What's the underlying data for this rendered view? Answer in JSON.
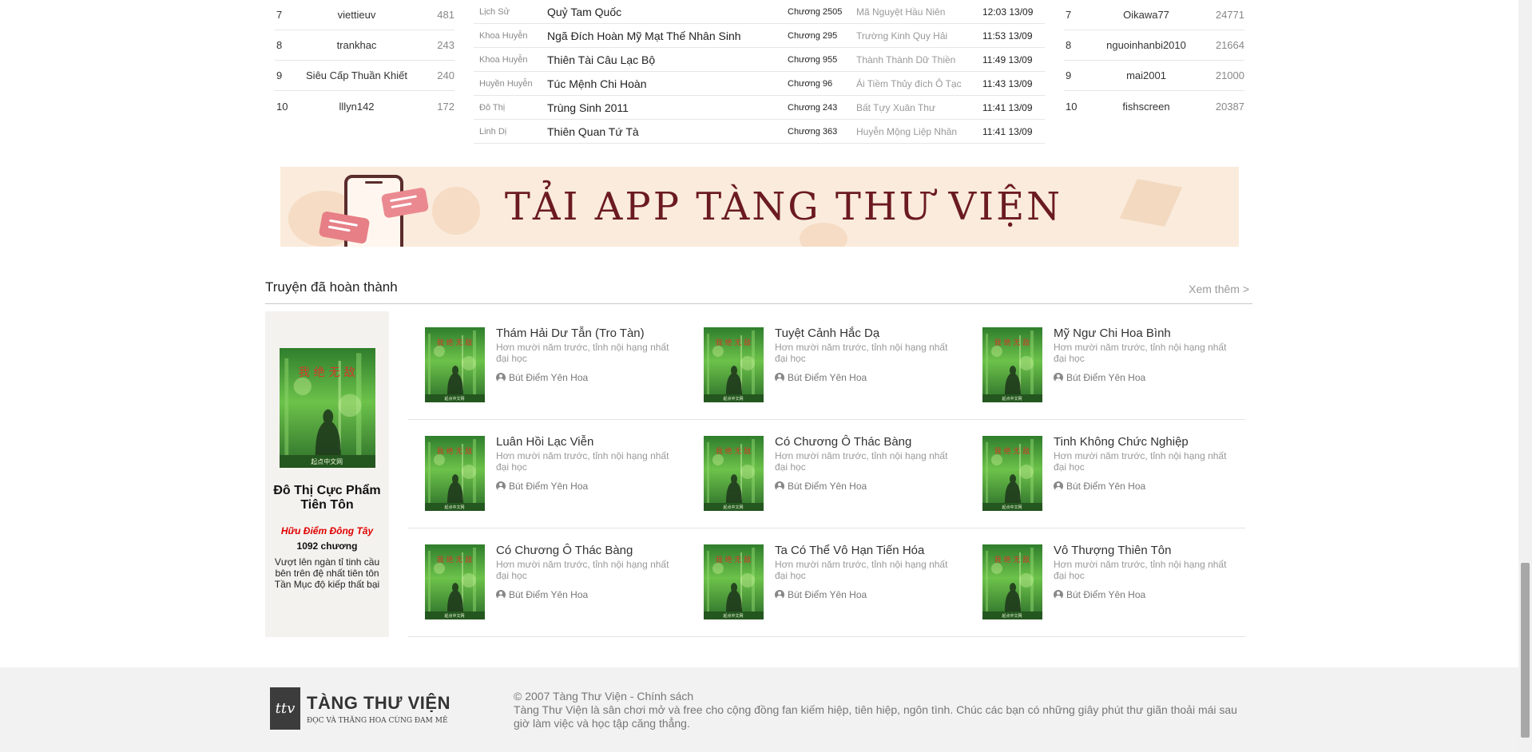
{
  "left_ranking": [
    {
      "rank": "7",
      "name": "viettieuv",
      "score": "481"
    },
    {
      "rank": "8",
      "name": "trankhac",
      "score": "243"
    },
    {
      "rank": "9",
      "name": "Siêu Cấp Thuần Khiết",
      "score": "240"
    },
    {
      "rank": "10",
      "name": "lllyn142",
      "score": "172"
    }
  ],
  "right_ranking": [
    {
      "rank": "7",
      "name": "Oikawa77",
      "score": "24771"
    },
    {
      "rank": "8",
      "name": "nguoinhanbi2010",
      "score": "21664"
    },
    {
      "rank": "9",
      "name": "mai2001",
      "score": "21000"
    },
    {
      "rank": "10",
      "name": "fishscreen",
      "score": "20387"
    }
  ],
  "updates": [
    {
      "genre": "Lịch Sử",
      "title": "Quỷ Tam Quốc",
      "chapter": "Chương 2505",
      "author": "Mã Nguyệt Hầu Niên",
      "time": "12:03 13/09"
    },
    {
      "genre": "Khoa Huyễn",
      "title": "Ngã Đích Hoàn Mỹ Mạt Thế Nhân Sinh",
      "chapter": "Chương 295",
      "author": "Trường Kinh Quy Hải",
      "time": "11:53 13/09"
    },
    {
      "genre": "Khoa Huyễn",
      "title": "Thiên Tài Câu Lạc Bộ",
      "chapter": "Chương 955",
      "author": "Thành Thành Dữ Thiền",
      "time": "11:49 13/09"
    },
    {
      "genre": "Huyền Huyễn",
      "title": "Túc Mệnh Chi Hoàn",
      "chapter": "Chương 96",
      "author": "Ái Tiềm Thủy đích Ô Tạc",
      "time": "11:43 13/09"
    },
    {
      "genre": "Đô Thị",
      "title": "Trùng Sinh 2011",
      "chapter": "Chương 243",
      "author": "Bất Tựy Xuân Thư",
      "time": "11:41 13/09"
    },
    {
      "genre": "Linh Dị",
      "title": "Thiên Quan Tứ Tà",
      "chapter": "Chương 363",
      "author": "Huyễn Mộng Liệp Nhân",
      "time": "11:41 13/09"
    }
  ],
  "banner": {
    "text": "TẢI APP TÀNG THƯ VIỆN"
  },
  "completed": {
    "heading": "Truyện đã hoàn thành",
    "more_label": "Xem thêm >",
    "featured": {
      "title": "Đô Thị Cực Phẩm Tiên Tôn",
      "author": "Hữu Điểm Đông Tây",
      "chapters": "1092 chương",
      "description": "Vượt lên ngàn tỉ tinh cầu bên trên đệ nhất tiên tôn Tần Mục độ kiếp thất bại"
    },
    "books": [
      {
        "title": "Thám Hải Dư Tẫn (Tro Tàn)",
        "description": "Hơn mười năm trước, tỉnh nội hạng nhất đại học",
        "author": "Bút Điểm Yên Hoa"
      },
      {
        "title": "Tuyệt Cảnh Hắc Dạ",
        "description": "Hơn mười năm trước, tỉnh nội hạng nhất đại học",
        "author": "Bút Điểm Yên Hoa"
      },
      {
        "title": "Mỹ Ngư Chi Hoa Bình",
        "description": "Hơn mười năm trước, tỉnh nội hạng nhất đại học",
        "author": "Bút Điểm Yên Hoa"
      },
      {
        "title": "Luân Hồi Lạc Viễn",
        "description": "Hơn mười năm trước, tỉnh nội hạng nhất đại học",
        "author": "Bút Điểm Yên Hoa"
      },
      {
        "title": "Có Chương Ô Thác Bàng",
        "description": "Hơn mười năm trước, tỉnh nội hạng nhất đại học",
        "author": "Bút Điểm Yên Hoa"
      },
      {
        "title": "Tinh Không Chức Nghiệp",
        "description": "Hơn mười năm trước, tỉnh nội hạng nhất đại học",
        "author": "Bút Điểm Yên Hoa"
      },
      {
        "title": "Có Chương Ô Thác Bàng",
        "description": "Hơn mười năm trước, tỉnh nội hạng nhất đại học",
        "author": "Bút Điểm Yên Hoa"
      },
      {
        "title": "Ta Có Thể Vô Hạn Tiến Hóa",
        "description": "Hơn mười năm trước, tỉnh nội hạng nhất đại học",
        "author": "Bút Điểm Yên Hoa"
      },
      {
        "title": "Vô Thượng Thiên Tôn",
        "description": "Hơn mười năm trước, tỉnh nội hạng nhất đại học",
        "author": "Bút Điểm Yên Hoa"
      }
    ]
  },
  "footer": {
    "logo_mark": "ttv",
    "brand": "TÀNG THƯ VIỆN",
    "slogan": "ĐỌC VÀ THĂNG HOA CÙNG ĐAM MÊ",
    "copyright": "© 2007 Tàng Thư Viện - Chính sách",
    "about": "Tàng Thư Viện là sân chơi mở và free cho cộng đồng fan kiếm hiệp, tiên hiệp, ngôn tình. Chúc các bạn có những giây phút thư giãn thoải mái sau giờ làm việc và học tập căng thẳng."
  },
  "colors": {
    "accent_red": "#e00000",
    "banner_text": "#6b1a22",
    "banner_bg": "#faebdc",
    "cover_green": "#3f9a3a"
  }
}
